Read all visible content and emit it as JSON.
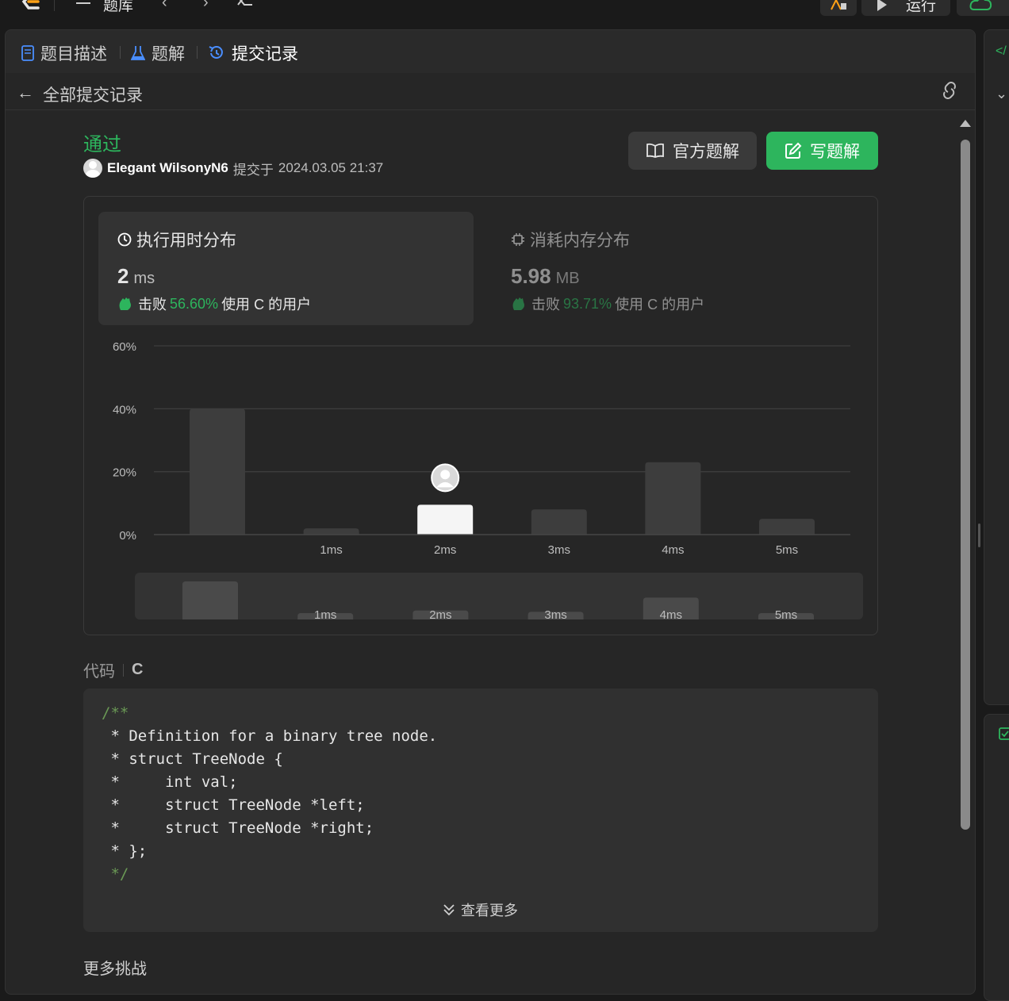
{
  "topbar": {
    "library": "题库",
    "run": "运行"
  },
  "tabs": [
    {
      "label": "题目描述"
    },
    {
      "label": "题解"
    },
    {
      "label": "提交记录"
    }
  ],
  "subheader": {
    "title": "全部提交记录"
  },
  "submission": {
    "status": "通过",
    "user": "Elegant WilsonyN6",
    "submitted_prefix": "提交于",
    "submitted_at": "2024.03.05 21:37",
    "official_btn": "官方题解",
    "write_btn": "写题解"
  },
  "runtime": {
    "title": "执行用时分布",
    "value": "2",
    "unit": "ms",
    "beat_prefix": "击败",
    "beat_pct": "56.60%",
    "beat_suffix": "使用 C 的用户"
  },
  "memory": {
    "title": "消耗内存分布",
    "value": "5.98",
    "unit": "MB",
    "beat_prefix": "击败",
    "beat_pct": "93.71%",
    "beat_suffix": "使用 C 的用户"
  },
  "chart_data": {
    "type": "bar",
    "categories": [
      "",
      "1ms",
      "2ms",
      "3ms",
      "4ms",
      "5ms"
    ],
    "values": [
      40,
      2,
      9.5,
      8,
      23,
      5
    ],
    "highlight_index": 2,
    "y_ticks": [
      "0%",
      "20%",
      "40%",
      "60%"
    ],
    "ylim": [
      0,
      60
    ],
    "grid": true,
    "colors": {
      "bar": "#3d3d3d",
      "highlight": "#f5f5f5",
      "grid": "#3d3d3d"
    },
    "minimap": {
      "labels": [
        "",
        "1ms",
        "2ms",
        "3ms",
        "4ms",
        "5ms"
      ],
      "values": [
        40,
        2,
        9.5,
        8,
        23,
        5
      ]
    }
  },
  "code": {
    "label": "代码",
    "language": "C",
    "lines": [
      {
        "text": "/**",
        "comment": true
      },
      {
        "text": " * Definition for a binary tree node.",
        "comment": false
      },
      {
        "text": " * struct TreeNode {",
        "comment": false
      },
      {
        "text": " *     int val;",
        "comment": false
      },
      {
        "text": " *     struct TreeNode *left;",
        "comment": false
      },
      {
        "text": " *     struct TreeNode *right;",
        "comment": false
      },
      {
        "text": " * };",
        "comment": false
      },
      {
        "text": " */",
        "comment": true
      }
    ],
    "more": "查看更多"
  },
  "more_challenges": "更多挑战"
}
